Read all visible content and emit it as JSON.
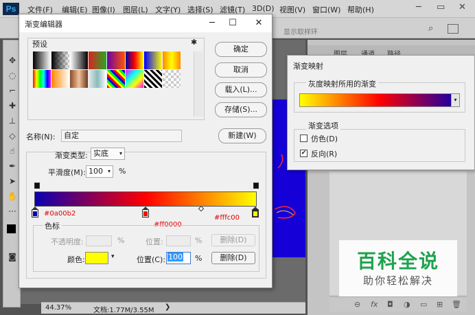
{
  "ps": {
    "logo": "Ps",
    "menu": [
      "文件(F)",
      "编辑(E)",
      "图像(I)",
      "图层(L)",
      "文字(Y)",
      "选择(S)",
      "滤镜(T)",
      "3D(D)",
      "视图(V)",
      "窗口(W)",
      "帮助(H)"
    ],
    "options_text": "显示取样环",
    "panel_tabs": [
      "图层",
      "通道",
      "路径"
    ],
    "status_zoom": "44.37%",
    "status_doc": "文档:1.77M/3.55M"
  },
  "watermark": {
    "title": "百科全说",
    "subtitle": "助你轻松解决"
  },
  "gradient_editor": {
    "title": "渐变编辑器",
    "presets_label": "预设",
    "buttons": {
      "ok": "确定",
      "cancel": "取消",
      "load": "载入(L)...",
      "save": "存储(S)...",
      "new": "新建(W)"
    },
    "name_label": "名称(N):",
    "name_value": "自定",
    "type_label": "渐变类型:",
    "type_value": "实底",
    "smooth_label": "平滑度(M):",
    "smooth_value": "100",
    "smooth_unit": "%",
    "stops_label_left": "#0a00b2",
    "stops_label_mid": "#ff0000",
    "stops_label_right": "#fffc00",
    "gradient_colors": [
      "#0a00b2",
      "#ff0000",
      "#ffff00"
    ],
    "color_group_label": "色标",
    "opacity_label": "不透明度:",
    "opacity_unit": "%",
    "location_label_1": "位置:",
    "location_unit_1": "%",
    "delete_label_1": "删除(D)",
    "color_label": "颜色:",
    "color_value": "#ffff00",
    "location_label_2": "位置(C):",
    "location_value": "100",
    "location_unit_2": "%",
    "delete_label_2": "删除(D)"
  },
  "gradient_map": {
    "title": "渐变映射",
    "group1_label": "灰度映射所用的渐变",
    "group2_label": "渐变选项",
    "dither_label": "仿色(D)",
    "dither_checked": false,
    "reverse_label": "反向(R)",
    "reverse_checked": true
  }
}
